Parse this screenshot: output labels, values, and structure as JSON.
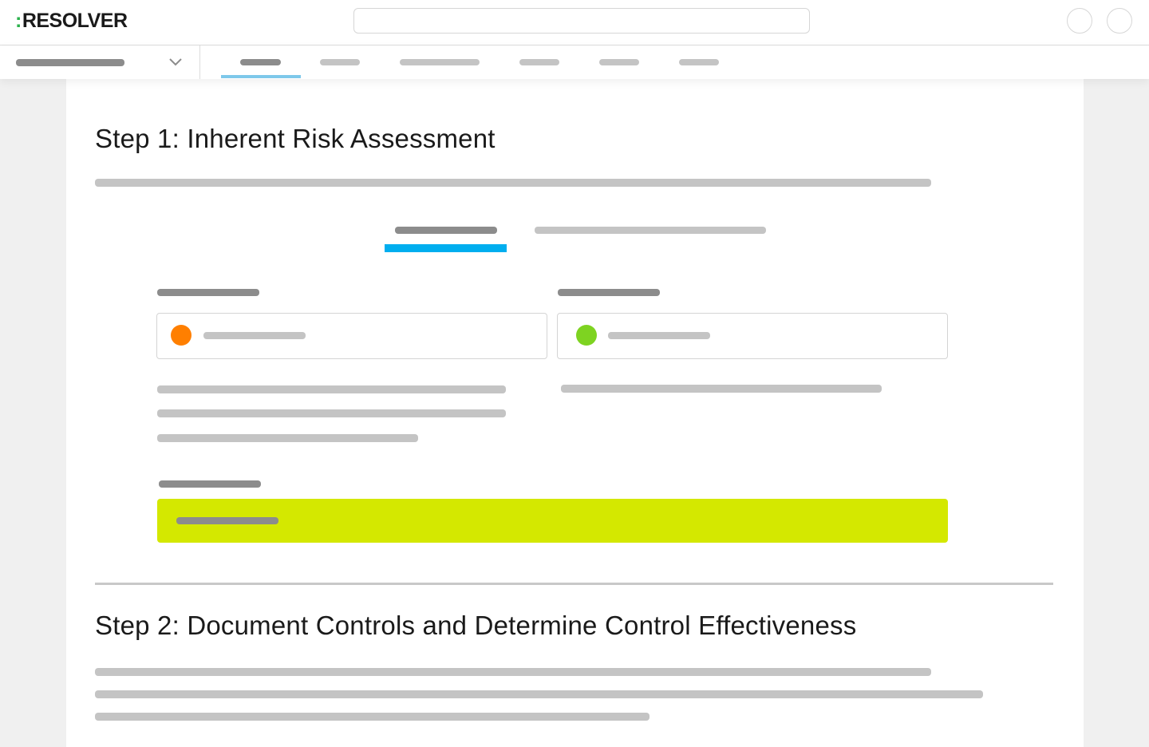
{
  "header": {
    "logo_text": "RESOLVER",
    "logo_colon": ":",
    "search_placeholder": ""
  },
  "icons": {
    "logo_accent_color": "#2bb24c",
    "dropdown": "chevron-down-icon"
  },
  "sections": {
    "step1_title": "Step 1: Inherent Risk Assessment",
    "step2_title": "Step 2: Document Controls and Determine Control Effectiveness"
  },
  "colors": {
    "active_tab": "#00aeef",
    "nav_active_underline": "#7ec8ea",
    "risk_orange": "#ff7f00",
    "risk_green": "#7ed321",
    "score_highlight": "#d4e800",
    "placeholder_dark": "#8c8c8c",
    "placeholder_light": "#c4c4c4"
  }
}
